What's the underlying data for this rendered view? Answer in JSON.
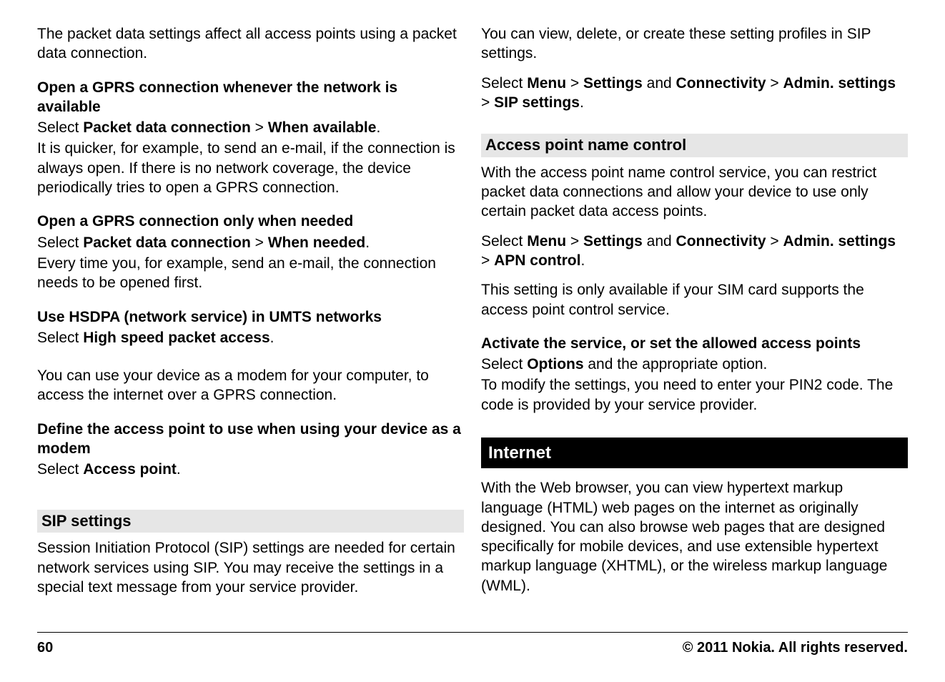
{
  "left": {
    "intro": "The packet data settings affect all access points using a packet data connection.",
    "s1": {
      "title": "Open a GPRS connection whenever the network is available",
      "select_prefix": "Select ",
      "select_b1": "Packet data connection",
      "select_sep": "  > ",
      "select_b2": "When available",
      "select_end": ".",
      "body": "It is quicker, for example, to send an e-mail, if the connection is always open. If there is no network coverage, the device periodically tries to open a GPRS connection."
    },
    "s2": {
      "title": "Open a GPRS connection only when needed",
      "select_prefix": "Select ",
      "select_b1": "Packet data connection",
      "select_sep": "  > ",
      "select_b2": "When needed",
      "select_end": ".",
      "body": "Every time you, for example, send an e-mail, the connection needs to be opened first."
    },
    "s3": {
      "title": "Use HSDPA (network service) in UMTS networks",
      "select_prefix": "Select ",
      "select_b1": "High speed packet access",
      "select_end": "."
    },
    "modem": "You can use your device as a modem for your computer, to access the internet over a GPRS connection.",
    "s4": {
      "title": "Define the access point to use when using your device as a modem",
      "select_prefix": "Select ",
      "select_b1": "Access point",
      "select_end": "."
    },
    "sip": {
      "heading": "SIP settings",
      "body": "Session Initiation Protocol (SIP) settings are needed for certain network services using SIP. You may receive the settings in a special text message from your service provider."
    }
  },
  "right": {
    "sipTop": "You can view, delete, or create these setting profiles in SIP settings.",
    "selSip": {
      "select_prefix": "Select ",
      "b1": "Menu",
      "sep1": "  > ",
      "b2": "Settings",
      "and": " and ",
      "b3": "Connectivity",
      "sep2": "  > ",
      "b4": "Admin. settings",
      "sep3": "  > ",
      "b5": "SIP settings",
      "end": "."
    },
    "apn": {
      "heading": "Access point name control",
      "body1": "With the access point name control service, you can restrict packet data connections and allow your device to use only certain packet data access points.",
      "sel": {
        "select_prefix": "Select ",
        "b1": "Menu",
        "sep1": "  > ",
        "b2": "Settings",
        "and": " and ",
        "b3": "Connectivity",
        "sep2": "  > ",
        "b4": "Admin. settings",
        "sep3": "  > ",
        "b5": "APN control",
        "end": "."
      },
      "body2": "This setting is only available if your SIM card supports the access point control service.",
      "s1": {
        "title": "Activate the service, or set the allowed access points",
        "select_prefix": "Select ",
        "b1": "Options",
        "rest": " and the appropriate option."
      },
      "body3": "To modify the settings, you need to enter your PIN2 code. The code is provided by your service provider."
    },
    "internet": {
      "heading": "Internet",
      "body": "With the Web browser, you can view hypertext markup language (HTML) web pages on the internet as originally designed. You can also browse web pages that are designed specifically for mobile devices, and use extensible hypertext markup language (XHTML), or the wireless markup language (WML)."
    }
  },
  "footer": {
    "page": "60",
    "copyright": "© 2011 Nokia. All rights reserved."
  }
}
